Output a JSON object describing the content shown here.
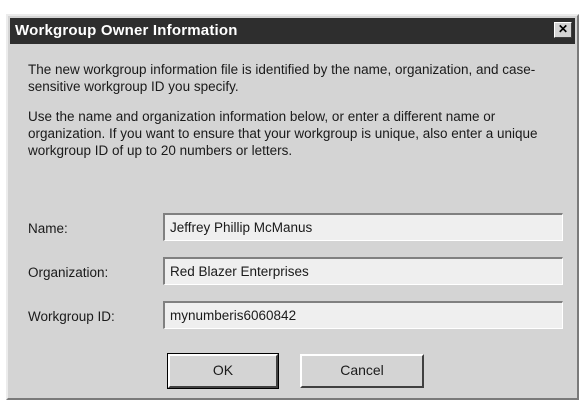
{
  "dialog": {
    "title": "Workgroup Owner Information",
    "close_glyph": "✕",
    "paragraph1": "The new workgroup information file is identified by the name, organization, and case-sensitive workgroup ID you specify.",
    "paragraph2": "Use the name and organization information below, or enter a different name or organization. If you want to ensure that your workgroup is unique, also enter a unique workgroup ID of up to 20 numbers or letters."
  },
  "fields": {
    "name": {
      "label": "Name:",
      "value": "Jeffrey Phillip McManus"
    },
    "organization": {
      "label": "Organization:",
      "value": "Red Blazer Enterprises"
    },
    "workgroup_id": {
      "label": "Workgroup ID:",
      "value": "mynumberis6060842"
    }
  },
  "buttons": {
    "ok": "OK",
    "cancel": "Cancel"
  },
  "colors": {
    "titlebar": "#2e2e2e",
    "dialog_face": "#d4d4d4",
    "field_bg": "#efefef"
  }
}
